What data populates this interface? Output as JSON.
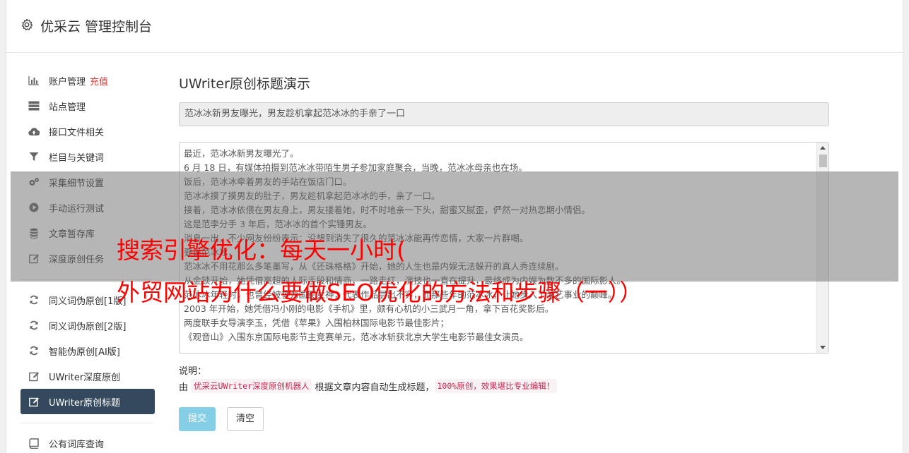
{
  "header": {
    "title": "优采云 管理控制台",
    "icon": "gear-icon"
  },
  "sidebar": {
    "items": [
      {
        "label": "账户管理",
        "badge": "充值",
        "icon": "bar-chart-icon"
      },
      {
        "label": "站点管理",
        "icon": "server-icon"
      },
      {
        "label": "接口文件相关",
        "icon": "cloud-upload-icon"
      },
      {
        "label": "栏目与关键词",
        "icon": "filter-icon"
      },
      {
        "label": "采集细节设置",
        "icon": "cogs-icon"
      },
      {
        "label": "手动运行测试",
        "icon": "play-circle-icon"
      },
      {
        "label": "文章暂存库",
        "icon": "database-icon"
      },
      {
        "label": "深度原创任务",
        "icon": "edit-icon"
      },
      {
        "label": "同义词伪原创[1版]",
        "icon": "refresh-icon"
      },
      {
        "label": "同义词伪原创[2版]",
        "icon": "refresh-icon"
      },
      {
        "label": "智能伪原创[AI版]",
        "icon": "refresh-icon"
      },
      {
        "label": "UWriter深度原创",
        "icon": "edit-icon"
      },
      {
        "label": "UWriter原创标题",
        "icon": "edit-icon",
        "active": true
      },
      {
        "label": "公有词库查询",
        "icon": "book-icon"
      }
    ]
  },
  "main": {
    "heading": "UWriter原创标题演示",
    "title_value": "范冰冰新男友曝光，男友趁机拿起范冰冰的手亲了一口",
    "content_lines": [
      "最近，范冰冰新男友曝光了。",
      "6 月 18 日，有媒体拍摄到范冰冰带陌生男子参加家庭聚会，当晚，范冰冰母亲也在场。",
      "饭后，范冰冰牵着男友的手站在饭店门口。",
      "范冰冰摸了摸男友的肚子，男友趁机拿起范冰冰的手，亲了一口。",
      "接着，范冰冰依偎在男友身上，男友搂着她，时不时地亲一下头，甜蜜又腻歪，俨然一对热恋期小情侣。",
      "这是范李分手 3 年后，范冰冰的首个实锤男友。",
      "消息一出，不少网友纷纷表示：没想到消失了很久的范冰冰能再传恋情，大家一片群嘲。",
      "要说范冰冰，",
      "范冰冰不用花那么多笔墨写，从《还珠格格》开始，她的人生也是内娱无法躲开的真人秀连续剧。",
      "从金锁开始，她凭借高超的人际手段和情商，一路走红，演技也一直在提升，最终成为内娱为数不多的国际影人。",
      "范冰冰年轻时，也曾经被誉为国民女神，代表作品层出不穷，而那些年的范冰冰，让她步入了演艺事业的巅峰。",
      "2003 年开始，她凭借冯小刚的电影《手机》里，颇有心机的小三武月一角，拿下百花奖影后。",
      "两度联手女导演李玉，凭借《苹果》入围柏林国际电影节最佳影片；",
      "《观音山》入围东京国际电影节主竞赛单元，范冰冰斩获北京大学生电影节最佳女演员。"
    ],
    "note_label": "说明：",
    "note_prefix": "由",
    "note_code1": "优采云UWriter深度原创机器人",
    "note_middle": "根据文章内容自动生成标题，",
    "note_code2": "100%原创，效果堪比专业编辑！",
    "submit_label": "提交",
    "clear_label": "清空"
  },
  "overlay": {
    "line1": "搜索引擎优化：每天一小时(",
    "line2": "外贸网站为什么要做SEO优化的方法和步骤（一））"
  }
}
